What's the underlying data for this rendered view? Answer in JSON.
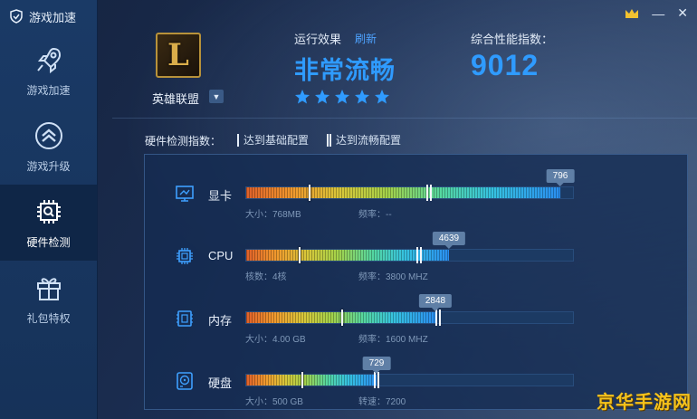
{
  "app": {
    "title": "游戏加速"
  },
  "sidebar": {
    "items": [
      {
        "label": "游戏加速",
        "icon": "rocket-icon"
      },
      {
        "label": "游戏升级",
        "icon": "chevron-up-circle-icon"
      },
      {
        "label": "硬件检测",
        "icon": "chip-icon",
        "active": true
      },
      {
        "label": "礼包特权",
        "icon": "gift-icon"
      }
    ]
  },
  "window": {
    "minimize": "—",
    "close": "✕",
    "crown_icon": "crown-icon"
  },
  "game": {
    "name": "英雄联盟",
    "logo_letter": "L"
  },
  "effect": {
    "label": "运行效果",
    "refresh": "刷新",
    "value": "非常流畅",
    "stars": 5
  },
  "score": {
    "label": "综合性能指数：",
    "value": "9012"
  },
  "legend": {
    "title": "硬件检测指数：",
    "basic": "达到基础配置",
    "smooth": "达到流畅配置"
  },
  "hardware": [
    {
      "name": "显卡",
      "icon": "monitor-icon",
      "score": "796",
      "fill": 0.96,
      "basic_tick": 0.19,
      "smooth_tick": 0.55,
      "spec1": "大小：768MB",
      "spec2": "频率：--"
    },
    {
      "name": "CPU",
      "icon": "cpu-icon",
      "score": "4639",
      "fill": 0.62,
      "basic_tick": 0.16,
      "smooth_tick": 0.52,
      "spec1": "核数：4核",
      "spec2": "频率：3800 MHZ"
    },
    {
      "name": "内存",
      "icon": "memory-icon",
      "score": "2848",
      "fill": 0.58,
      "basic_tick": 0.29,
      "smooth_tick": 0.58,
      "spec1": "大小：4.00 GB",
      "spec2": "频率：1600 MHZ"
    },
    {
      "name": "硬盘",
      "icon": "disk-icon",
      "score": "729",
      "fill": 0.4,
      "basic_tick": 0.17,
      "smooth_tick": 0.39,
      "spec1": "大小：500 GB",
      "spec2": "转速：7200"
    }
  ],
  "watermark": "京华手游网",
  "colors": {
    "accent": "#2f9bff",
    "sidebar": "#1a3a66",
    "watermark": "#f4c21c"
  }
}
